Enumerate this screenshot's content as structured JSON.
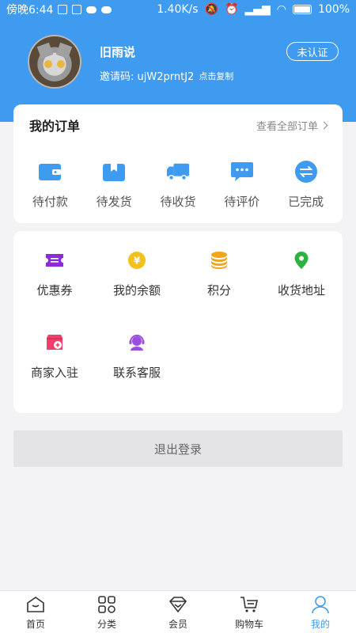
{
  "status_bar": {
    "time": "傍晚6:44",
    "speed": "1.40K/s",
    "battery": "100%"
  },
  "profile": {
    "username": "旧雨说",
    "invite_label": "邀请码: ujW2prntJ2",
    "copy_label": "点击复制",
    "verify_label": "未认证"
  },
  "orders": {
    "title": "我的订单",
    "view_all": "查看全部订单",
    "items": [
      {
        "label": "待付款",
        "icon": "wallet-icon"
      },
      {
        "label": "待发货",
        "icon": "box-icon"
      },
      {
        "label": "待收货",
        "icon": "truck-icon"
      },
      {
        "label": "待评价",
        "icon": "comment-icon"
      },
      {
        "label": "已完成",
        "icon": "exchange-icon"
      }
    ]
  },
  "services": {
    "items": [
      {
        "label": "优惠券",
        "icon": "coupon-icon",
        "color": "#8e2bd6"
      },
      {
        "label": "我的余额",
        "icon": "yen-coin-icon",
        "color": "#f2c21b"
      },
      {
        "label": "积分",
        "icon": "coins-stack-icon",
        "color": "#f2a51b"
      },
      {
        "label": "收货地址",
        "icon": "location-pin-icon",
        "color": "#2bb33f"
      },
      {
        "label": "商家入驻",
        "icon": "store-icon",
        "color": "#f0406a"
      },
      {
        "label": "联系客服",
        "icon": "customer-service-icon",
        "color": "#9b4ee0"
      }
    ]
  },
  "logout_label": "退出登录",
  "tabs": [
    {
      "label": "首页",
      "icon": "home-icon"
    },
    {
      "label": "分类",
      "icon": "category-icon"
    },
    {
      "label": "会员",
      "icon": "diamond-icon"
    },
    {
      "label": "购物车",
      "icon": "cart-icon"
    },
    {
      "label": "我的",
      "icon": "user-icon",
      "active": true
    }
  ],
  "colors": {
    "primary": "#3f9bf0",
    "background": "#f3f3f5"
  }
}
